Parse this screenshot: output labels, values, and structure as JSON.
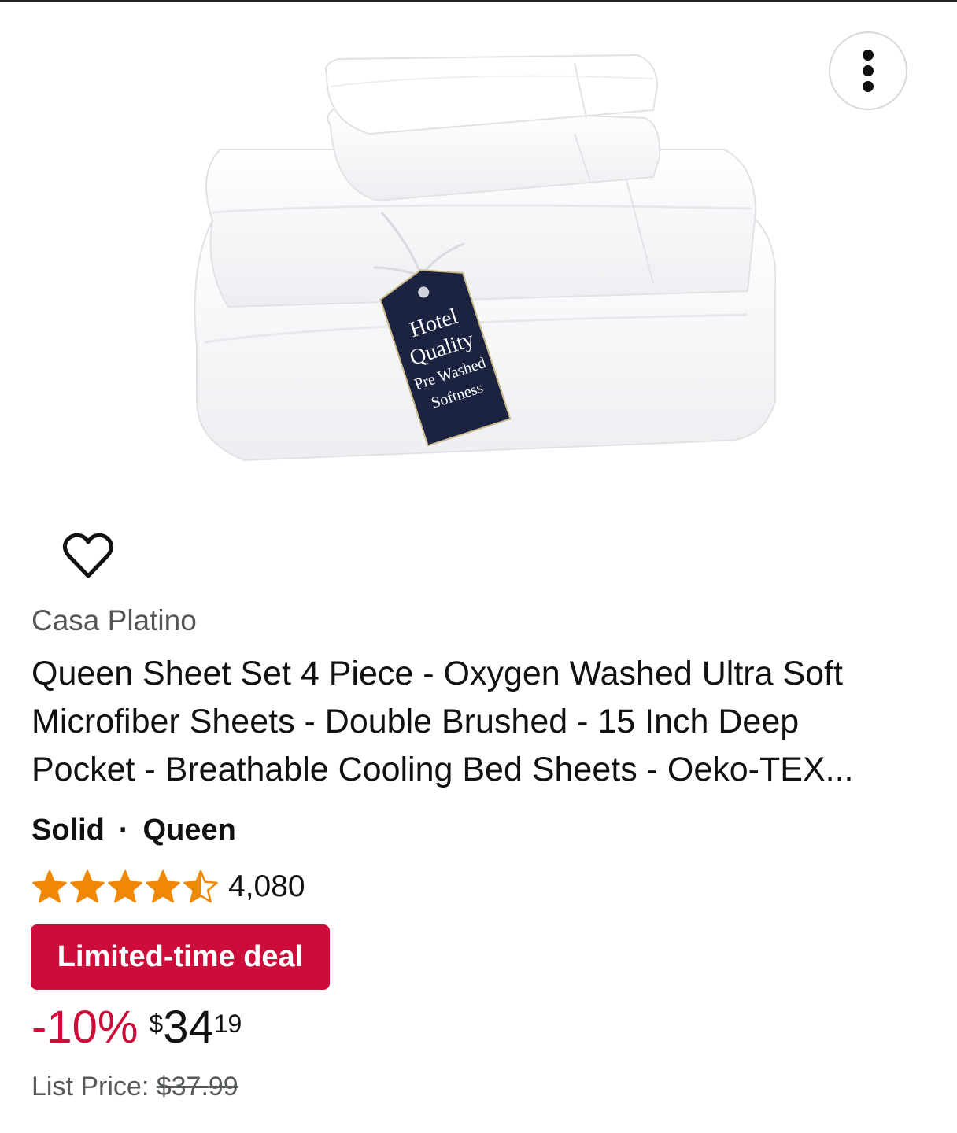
{
  "product": {
    "brand": "Casa Platino",
    "title": "Queen Sheet Set 4 Piece - Oxygen Washed Ultra Soft Microfiber Sheets - Double Brushed - 15 Inch Deep Pocket - Breathable Cooling Bed Sheets - Oeko-TEX...",
    "variant": {
      "pattern": "Solid",
      "separator": "·",
      "size": "Queen"
    },
    "rating": {
      "stars": 4.5,
      "count": "4,080"
    },
    "deal_label": "Limited-time deal",
    "price": {
      "discount": "-10%",
      "currency": "$",
      "whole": "34",
      "fraction": "19",
      "list_label": "List Price:",
      "list_value": "$37.99"
    },
    "image": {
      "tag_lines": [
        "Hotel",
        "Quality",
        "Pre Washed",
        "Softness"
      ]
    }
  },
  "icons": {
    "more": "more-vertical-icon",
    "favorite": "heart-outline-icon",
    "star": "star-icon"
  },
  "colors": {
    "deal": "#cc0c39",
    "star": "#f08804",
    "muted": "#565959",
    "tag": "#1c2340"
  }
}
